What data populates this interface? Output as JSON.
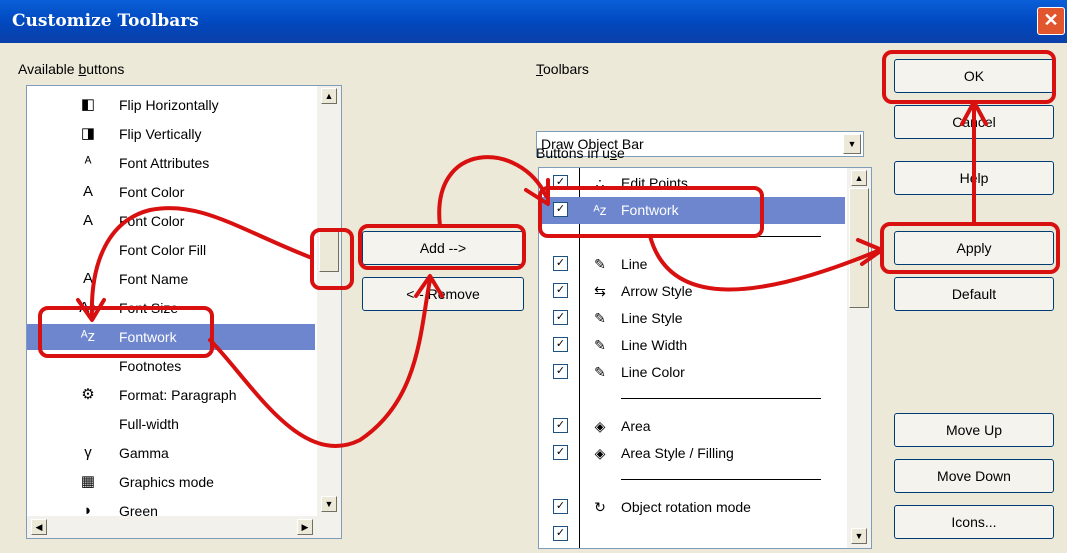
{
  "window": {
    "title": "Customize Toolbars",
    "close_glyph": "✕"
  },
  "available": {
    "label_pre": "Available ",
    "label_u": "b",
    "label_post": "uttons",
    "items": [
      {
        "label": "Flip Horizontally",
        "icon": "flip-horizontal-icon",
        "glyph": "◧",
        "selected": false
      },
      {
        "label": "Flip Vertically",
        "icon": "flip-vertical-icon",
        "glyph": "◨",
        "selected": false
      },
      {
        "label": "Font Attributes",
        "icon": "font-attributes-icon",
        "glyph": "ᴬ",
        "selected": false
      },
      {
        "label": "Font Color",
        "icon": "font-color-icon",
        "glyph": "A",
        "selected": false
      },
      {
        "label": "Font Color",
        "icon": "font-color-icon",
        "glyph": "A",
        "selected": false
      },
      {
        "label": "Font Color Fill",
        "icon": "",
        "glyph": "",
        "selected": false
      },
      {
        "label": "Font Name",
        "icon": "font-name-icon",
        "glyph": "A",
        "selected": false
      },
      {
        "label": "Font Size",
        "icon": "font-size-icon",
        "glyph": "A↕",
        "selected": false
      },
      {
        "label": "Fontwork",
        "icon": "fontwork-icon",
        "glyph": "ᴬᴢ",
        "selected": true
      },
      {
        "label": "Footnotes",
        "icon": "",
        "glyph": "",
        "selected": false
      },
      {
        "label": "Format: Paragraph",
        "icon": "format-paragraph-icon",
        "glyph": "⚙",
        "selected": false
      },
      {
        "label": "Full-width",
        "icon": "",
        "glyph": "",
        "selected": false
      },
      {
        "label": "Gamma",
        "icon": "gamma-icon",
        "glyph": "γ",
        "selected": false
      },
      {
        "label": "Graphics mode",
        "icon": "graphics-mode-icon",
        "glyph": "▦",
        "selected": false
      },
      {
        "label": "Green",
        "icon": "green-icon",
        "glyph": "◗",
        "selected": false
      }
    ]
  },
  "toolbars": {
    "label_u": "T",
    "label_post": "oolbars",
    "selected": "Draw Object Bar"
  },
  "in_use": {
    "label_pre": "Buttons in u",
    "label_u": "s",
    "label_post": "e",
    "items": [
      {
        "type": "item",
        "label": "Edit Points",
        "icon": "edit-points-icon",
        "glyph": "∴",
        "checked": true,
        "selected": false
      },
      {
        "type": "item",
        "label": "Fontwork",
        "icon": "fontwork-icon",
        "glyph": "ᴬᴢ",
        "checked": true,
        "selected": true
      },
      {
        "type": "separator"
      },
      {
        "type": "item",
        "label": "Line",
        "icon": "line-icon",
        "glyph": "✎",
        "checked": true,
        "selected": false
      },
      {
        "type": "item",
        "label": "Arrow Style",
        "icon": "arrow-style-icon",
        "glyph": "⇆",
        "checked": true,
        "selected": false
      },
      {
        "type": "item",
        "label": "Line Style",
        "icon": "line-style-icon",
        "glyph": "✎",
        "checked": true,
        "selected": false
      },
      {
        "type": "item",
        "label": "Line Width",
        "icon": "line-width-icon",
        "glyph": "✎",
        "checked": true,
        "selected": false
      },
      {
        "type": "item",
        "label": "Line Color",
        "icon": "line-color-icon",
        "glyph": "✎",
        "checked": true,
        "selected": false
      },
      {
        "type": "separator"
      },
      {
        "type": "item",
        "label": "Area",
        "icon": "area-icon",
        "glyph": "◈",
        "checked": true,
        "selected": false
      },
      {
        "type": "item",
        "label": "Area Style / Filling",
        "icon": "area-style-icon",
        "glyph": "◈",
        "checked": true,
        "selected": false
      },
      {
        "type": "separator"
      },
      {
        "type": "item",
        "label": "Object rotation mode",
        "icon": "rotation-icon",
        "glyph": "↻",
        "checked": true,
        "selected": false
      },
      {
        "type": "item",
        "label": "",
        "icon": "",
        "glyph": "",
        "checked": true,
        "selected": false
      }
    ]
  },
  "buttons": {
    "add": "Add -->",
    "remove": "<-- Remove",
    "ok": "OK",
    "cancel": "Cancel",
    "help": "Help",
    "apply": "Apply",
    "default": "Default",
    "move_up": "Move Up",
    "move_down": "Move Down",
    "icons": "Icons..."
  },
  "colors": {
    "annotation": "#d81010",
    "selection": "#6d86ce",
    "title_bar": "#0149c0"
  }
}
